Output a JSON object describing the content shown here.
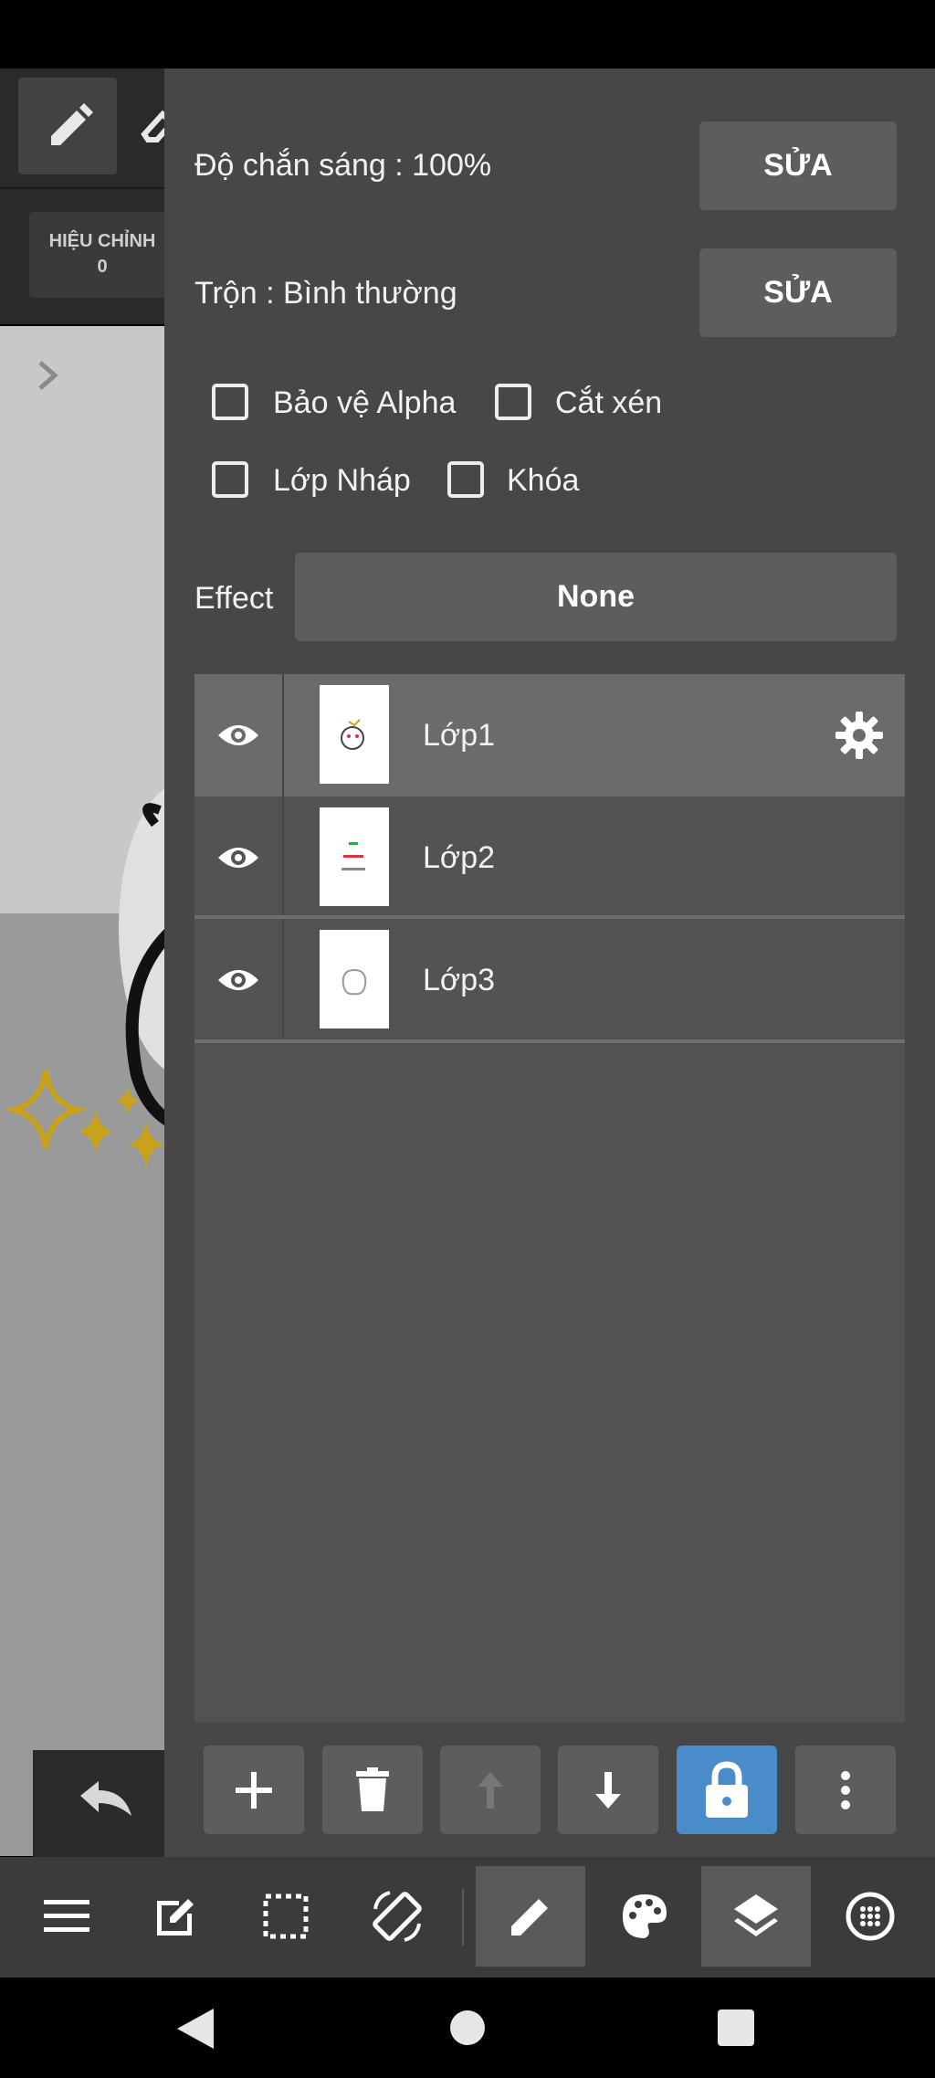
{
  "left": {
    "adjust_label": "HIỆU CHỈNH",
    "adjust_value": "0"
  },
  "panel": {
    "opacity_label": "Độ chắn sáng : 100%",
    "opacity_edit": "SỬA",
    "blend_label": "Trộn : Bình thường",
    "blend_edit": "SỬA",
    "checkboxes": {
      "alpha_protect": "Bảo vệ Alpha",
      "clipping": "Cắt xén",
      "draft_layer": "Lớp Nháp",
      "lock": "Khóa"
    },
    "effect_label": "Effect",
    "effect_value": "None"
  },
  "layers": [
    {
      "name": "Lớp1"
    },
    {
      "name": "Lớp2"
    },
    {
      "name": "Lớp3"
    }
  ],
  "colors": {
    "accent": "#4a8bc9",
    "panel_bg": "#474747",
    "button_bg": "#5d5d5d",
    "selected_row": "#6b6b6b"
  },
  "icons": {
    "toolbar": [
      "plus-icon",
      "trash-icon",
      "arrow-up-icon",
      "arrow-down-icon",
      "lock-icon",
      "more-vertical-icon"
    ],
    "bottom_bar": [
      "menu-icon",
      "edit-icon",
      "selection-icon",
      "rotate-screen-icon",
      "pen-icon",
      "palette-icon",
      "layers-icon",
      "material-icon"
    ],
    "nav": [
      "back-icon",
      "home-icon",
      "recents-icon"
    ]
  }
}
